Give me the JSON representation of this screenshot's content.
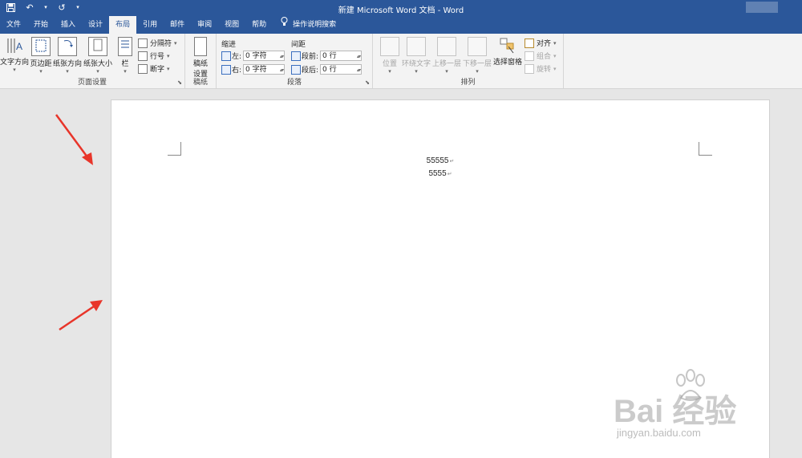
{
  "window": {
    "title": "新建 Microsoft Word 文档 - Word"
  },
  "qat": {
    "save_icon": "save-icon",
    "undo_icon": "undo-icon",
    "redo_icon": "redo-icon",
    "customize_icon": "customize-icon"
  },
  "tabs": [
    {
      "label": "文件"
    },
    {
      "label": "开始"
    },
    {
      "label": "插入"
    },
    {
      "label": "设计"
    },
    {
      "label": "布局",
      "active": true
    },
    {
      "label": "引用"
    },
    {
      "label": "邮件"
    },
    {
      "label": "审阅"
    },
    {
      "label": "视图"
    },
    {
      "label": "帮助"
    }
  ],
  "tell_me": "操作说明搜索",
  "ribbon": {
    "page_setup": {
      "label": "页面设置",
      "text_direction": "文字方向",
      "margins": "页边距",
      "orientation": "纸张方向",
      "size": "纸张大小",
      "columns": "栏",
      "breaks": "分隔符",
      "line_numbers": "行号",
      "hyphenation": "断字"
    },
    "manuscript": {
      "label": "稿纸",
      "button": "稿纸\n设置",
      "button_line1": "稿纸",
      "button_line2": "设置"
    },
    "paragraph": {
      "label": "段落",
      "indent_title": "缩进",
      "spacing_title": "间距",
      "left_label": "左:",
      "left_value": "0 字符",
      "right_label": "右:",
      "right_value": "0 字符",
      "before_label": "段前:",
      "before_value": "0 行",
      "after_label": "段后:",
      "after_value": "0 行"
    },
    "arrange": {
      "label": "排列",
      "position": "位置",
      "wrap_text": "环绕文字",
      "bring_forward": "上移一层",
      "send_backward": "下移一层",
      "selection_pane": "选择窗格",
      "align": "对齐",
      "group": "组合",
      "rotate": "旋转"
    }
  },
  "document": {
    "lines": [
      "55555",
      "5555"
    ],
    "paragraph_mark": "↵"
  },
  "watermark": {
    "text": "Bai 经验",
    "url": "jingyan.baidu.com"
  },
  "colors": {
    "title_bar": "#2b579a",
    "ribbon": "#f3f3f3",
    "canvas": "#e6e6e6",
    "arrow": "#e8352a"
  }
}
